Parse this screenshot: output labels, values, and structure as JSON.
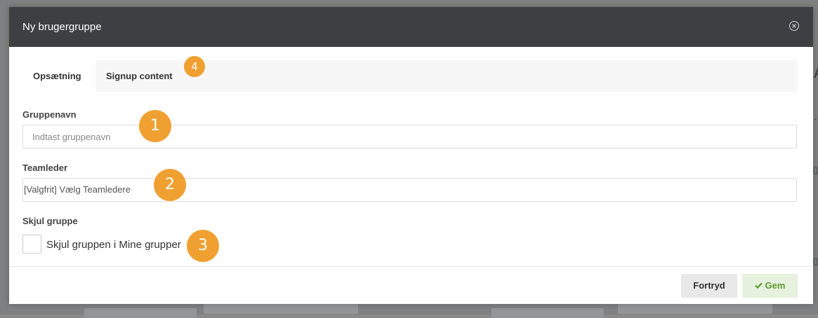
{
  "modal": {
    "title": "Ny brugergruppe",
    "tabs": [
      {
        "label": "Opsætning",
        "active": true
      },
      {
        "label": "Signup content",
        "active": false
      }
    ],
    "fields": {
      "group_name": {
        "label": "Gruppenavn",
        "value": "",
        "placeholder": "Indtast gruppenavn"
      },
      "team_leader": {
        "label": "Teamleder",
        "selected": "[Valgfrit] Vælg Teamledere"
      },
      "hide_group": {
        "label": "Skjul gruppe",
        "checkbox_label": "Skjul gruppen i Mine grupper",
        "checked": false
      }
    },
    "buttons": {
      "cancel": "Fortryd",
      "save": "Gem"
    }
  },
  "badges": [
    "1",
    "2",
    "3",
    "4"
  ],
  "colors": {
    "header_bg": "#3d3f42",
    "badge": "#f0a031",
    "save_bg": "#e6f2dd",
    "save_text": "#5a9a2f",
    "overlay": "#7f8081"
  },
  "icons": {
    "close": "close-circle-icon",
    "save": "checkmark-icon"
  }
}
